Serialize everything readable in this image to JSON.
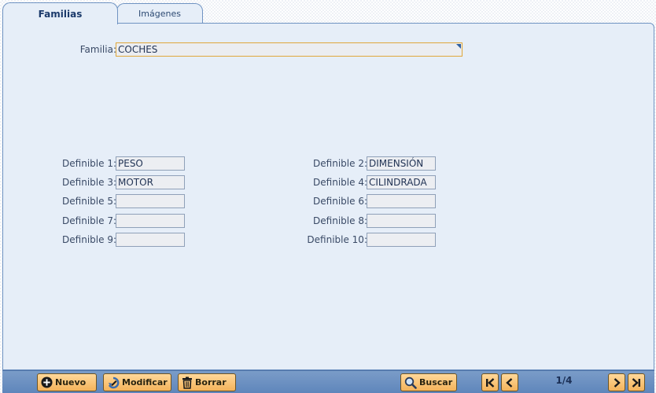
{
  "tabs": [
    {
      "label": "Familias",
      "active": true
    },
    {
      "label": "Imágenes",
      "active": false
    }
  ],
  "form": {
    "familia_label": "Familia:",
    "familia_value": "COCHES",
    "definibles": [
      {
        "label": "Definible 1:",
        "value": "PESO"
      },
      {
        "label": "Definible 2:",
        "value": "DIMENSIÓN"
      },
      {
        "label": "Definible 3:",
        "value": "MOTOR"
      },
      {
        "label": "Definible 4:",
        "value": "CILINDRADA"
      },
      {
        "label": "Definible 5:",
        "value": ""
      },
      {
        "label": "Definible 6:",
        "value": ""
      },
      {
        "label": "Definible 7:",
        "value": ""
      },
      {
        "label": "Definible 8:",
        "value": ""
      },
      {
        "label": "Definible 9:",
        "value": ""
      },
      {
        "label": "Definible 10:",
        "value": ""
      }
    ]
  },
  "toolbar": {
    "nuevo": "Nuevo",
    "modificar": "Modificar",
    "borrar": "Borrar",
    "buscar": "Buscar",
    "pager": "1/4"
  },
  "icons": {
    "nuevo": "plus-circle-icon",
    "modificar": "edit-icon",
    "borrar": "trash-icon",
    "buscar": "magnifier-icon",
    "first": "first-page-icon",
    "prev": "prev-page-icon",
    "next": "next-page-icon",
    "last": "last-page-icon"
  },
  "colors": {
    "panel": "#e6eef8",
    "toolbar": "#6f93c2",
    "button": "#f4b35a",
    "focus_border": "#e0a73a"
  }
}
